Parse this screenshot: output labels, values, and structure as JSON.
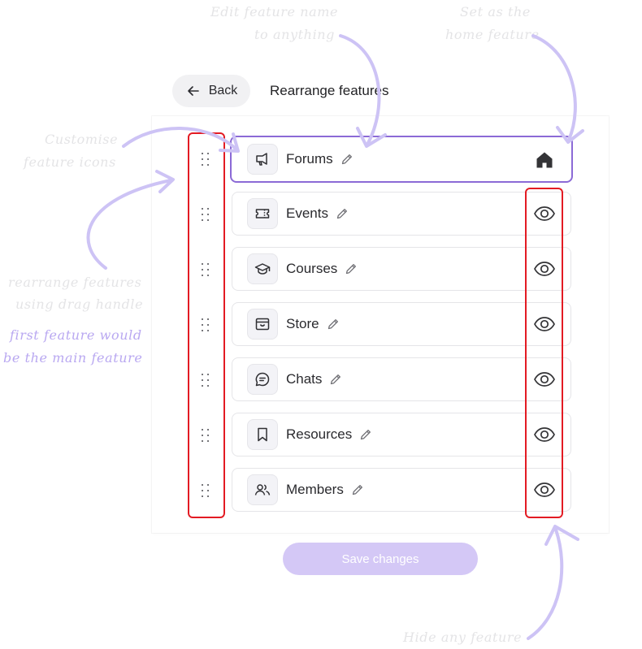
{
  "header": {
    "back_label": "Back",
    "title": "Rearrange features"
  },
  "features": [
    {
      "name": "Forums",
      "icon": "megaphone-icon",
      "home": true,
      "visible": true
    },
    {
      "name": "Events",
      "icon": "ticket-icon",
      "home": false,
      "visible": true
    },
    {
      "name": "Courses",
      "icon": "graduation-cap-icon",
      "home": false,
      "visible": true
    },
    {
      "name": "Store",
      "icon": "store-box-icon",
      "home": false,
      "visible": true
    },
    {
      "name": "Chats",
      "icon": "chat-bubble-icon",
      "home": false,
      "visible": true
    },
    {
      "name": "Resources",
      "icon": "bookmark-icon",
      "home": false,
      "visible": true
    },
    {
      "name": "Members",
      "icon": "users-icon",
      "home": false,
      "visible": true
    }
  ],
  "actions": {
    "save_label": "Save changes"
  },
  "annotations": {
    "edit_name_1": "Edit feature name",
    "edit_name_2": "to anything",
    "home_1": "Set as the",
    "home_2": "home feature",
    "icons_1": "Customise",
    "icons_2": "feature icons",
    "rearrange_1": "rearrange features",
    "rearrange_2": "using drag handle",
    "main_1": "first feature would",
    "main_2": "be the main feature",
    "hide": "Hide any feature"
  },
  "colors": {
    "accent_purple": "#8b6ad6",
    "save_button_disabled": "#d4c8f6",
    "annotation_red": "#e31b23",
    "annotation_arrow": "#cdc3f5"
  }
}
